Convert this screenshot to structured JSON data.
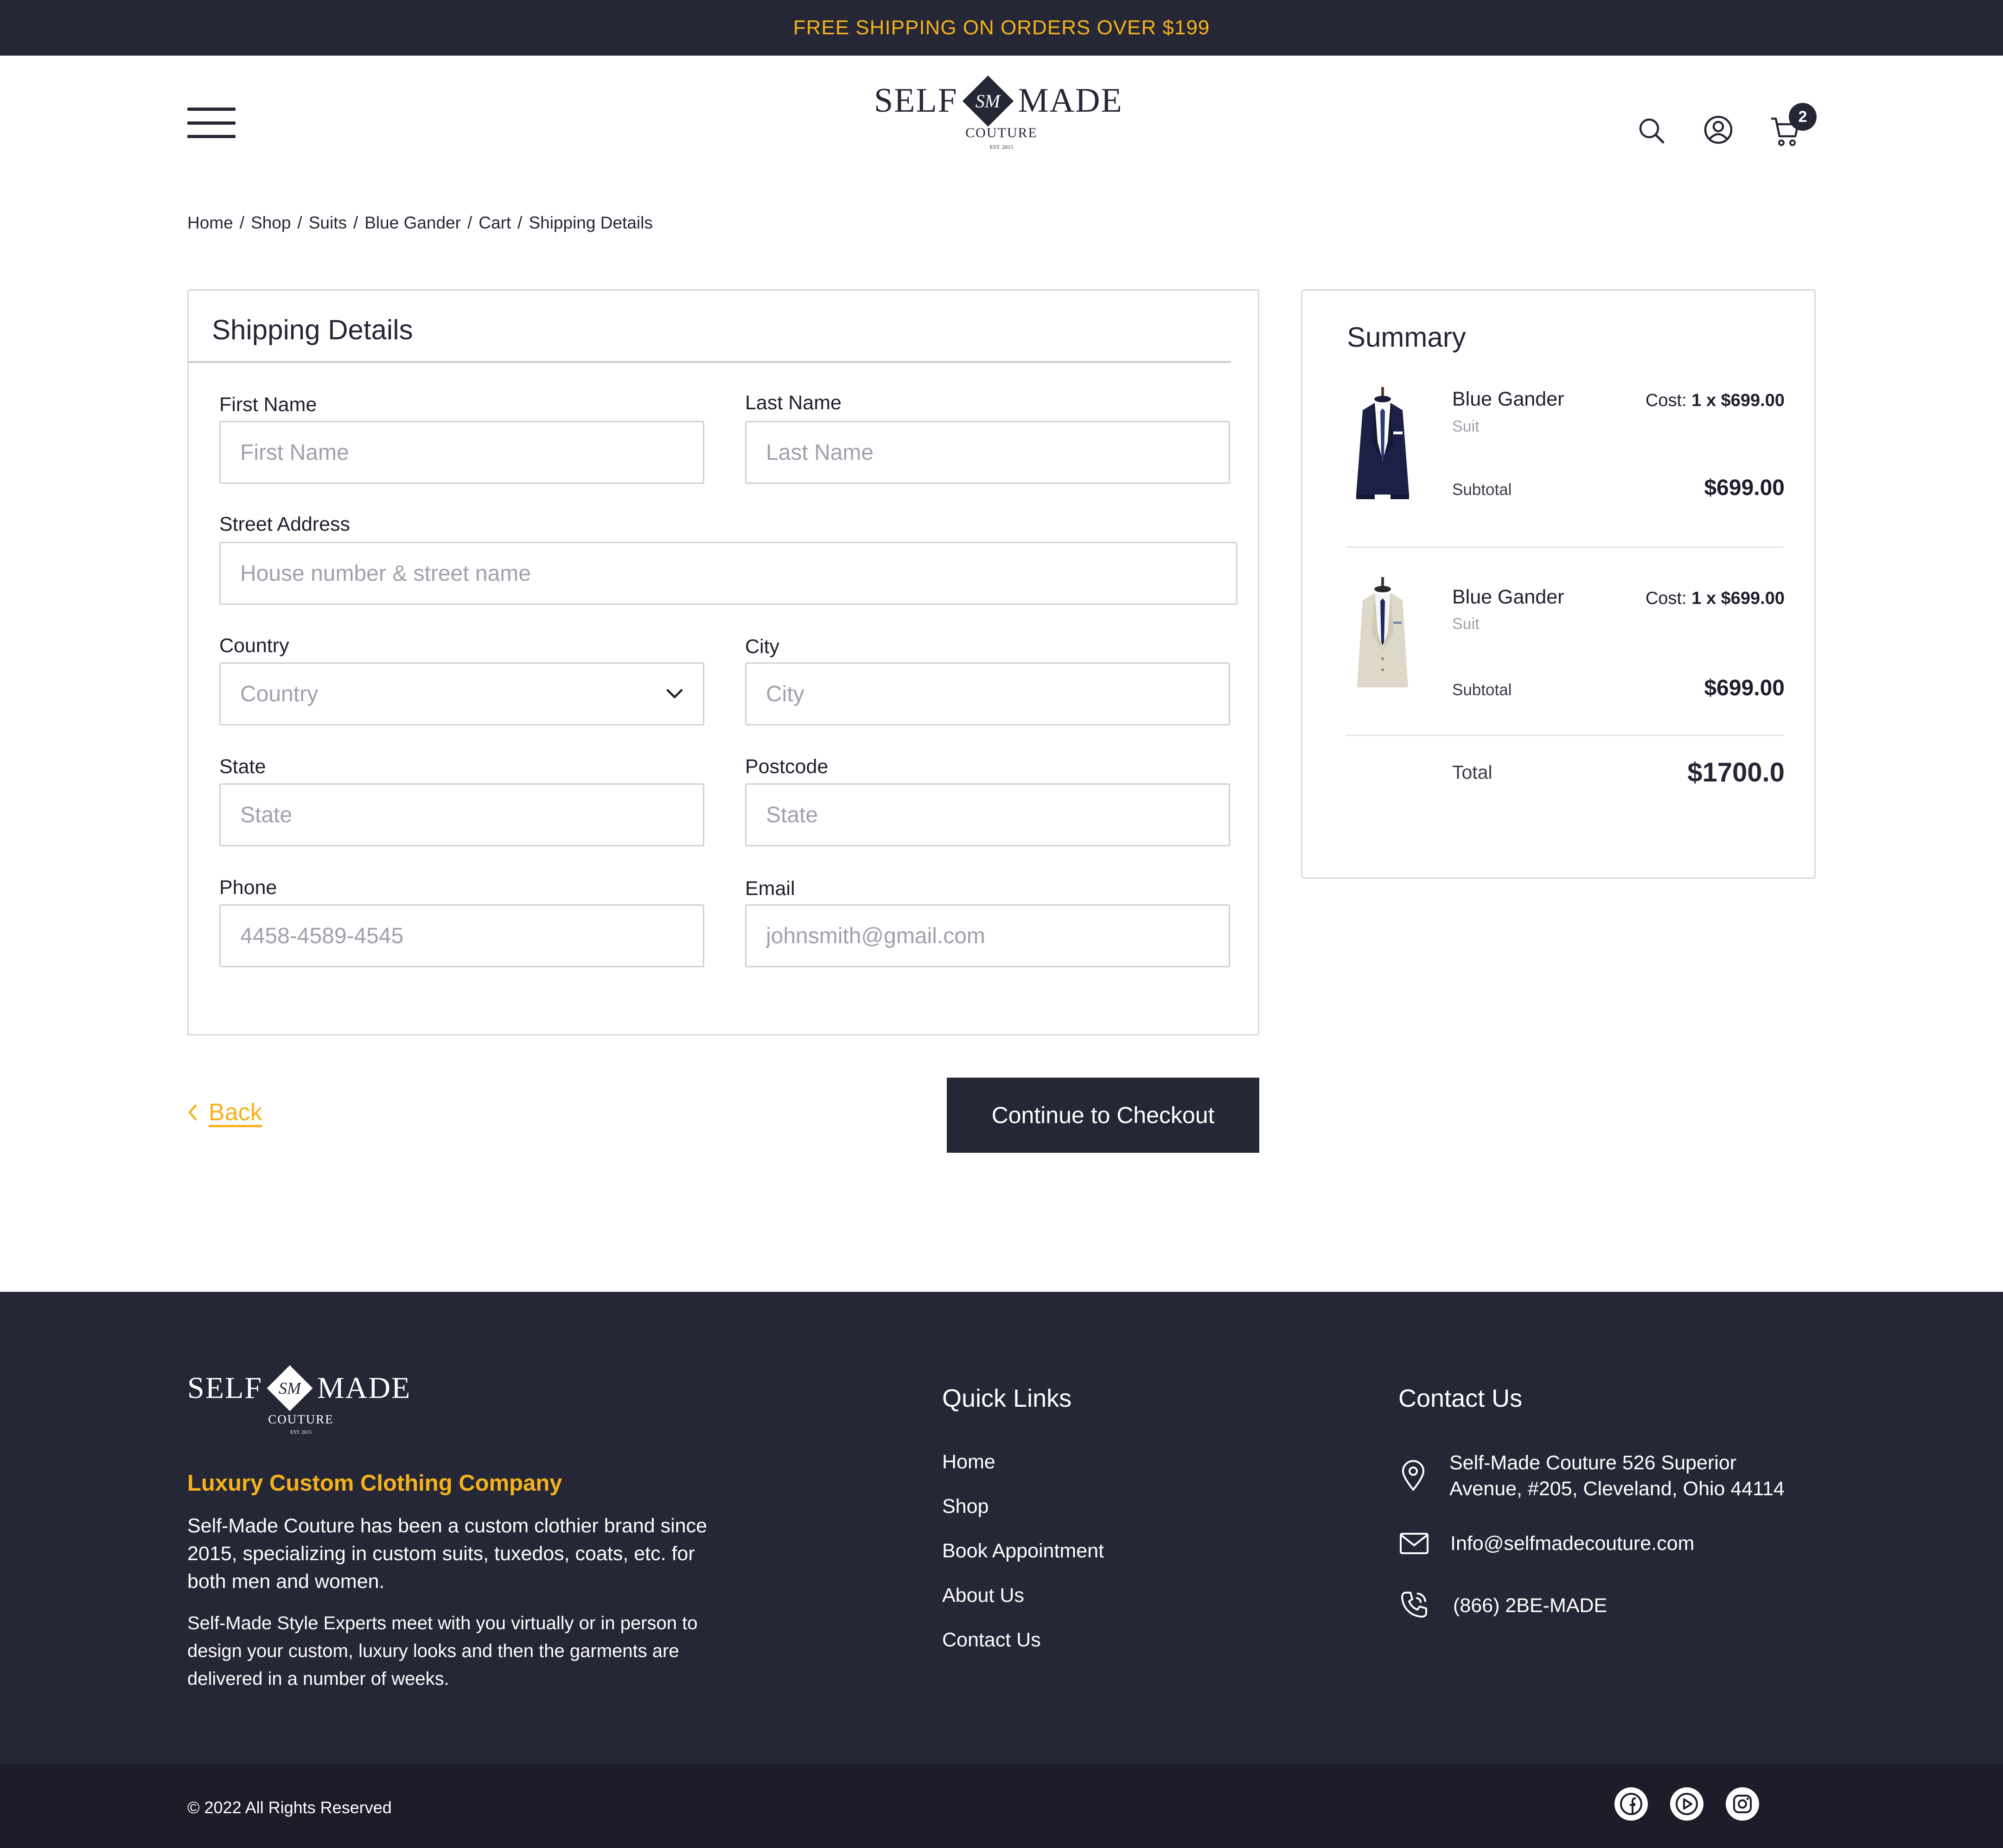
{
  "announcement": "FREE SHIPPING ON ORDERS OVER $199",
  "brand": {
    "word_left": "SELF",
    "word_right": "MADE",
    "monogram": "SM",
    "subtitle": "COUTURE",
    "est": "EST. 2015"
  },
  "header": {
    "menu_icon": "hamburger-menu-icon",
    "search_icon": "search-icon",
    "account_icon": "user-account-icon",
    "cart_icon": "shopping-cart-icon",
    "cart_count": "2"
  },
  "breadcrumb": [
    "Home",
    "Shop",
    "Suits",
    "Blue Gander",
    "Cart",
    "Shipping Details"
  ],
  "shipping": {
    "title": "Shipping Details",
    "first_name": {
      "label": "First Name",
      "placeholder": "First Name"
    },
    "last_name": {
      "label": "Last Name",
      "placeholder": "Last Name"
    },
    "street": {
      "label": "Street Address",
      "placeholder": "House number & street name"
    },
    "country": {
      "label": "Country",
      "placeholder": "Country"
    },
    "city": {
      "label": "City",
      "placeholder": "City"
    },
    "state": {
      "label": "State",
      "placeholder": "State"
    },
    "postcode": {
      "label": "Postcode",
      "placeholder": "State"
    },
    "phone": {
      "label": "Phone",
      "placeholder": "4458-4589-4545"
    },
    "email": {
      "label": "Email",
      "placeholder": "johnsmith@gmail.com"
    }
  },
  "summary": {
    "title": "Summary",
    "items": [
      {
        "name": "Blue Gander",
        "type": "Suit",
        "cost_label": "Cost:",
        "cost_value": "1 x $699.00",
        "subtotal_label": "Subtotal",
        "subtotal": "$699.00",
        "image": "navy-suit-image"
      },
      {
        "name": "Blue Gander",
        "type": "Suit",
        "cost_label": "Cost:",
        "cost_value": "1 x $699.00",
        "subtotal_label": "Subtotal",
        "subtotal": "$699.00",
        "image": "beige-suit-image"
      }
    ],
    "total_label": "Total",
    "total": "$1700.0"
  },
  "actions": {
    "back": "Back",
    "continue": "Continue to Checkout"
  },
  "footer": {
    "tagline": "Luxury Custom Clothing Company",
    "para1": "Self-Made Couture has been a custom clothier brand since 2015, specializing in custom suits, tuxedos, coats, etc. for both men and women.",
    "para2": "Self-Made Style Experts meet with you virtually or in person to design your custom, luxury looks and then the garments are delivered in a number of weeks.",
    "quick_links_title": "Quick Links",
    "quick_links": [
      "Home",
      "Shop",
      "Book Appointment",
      "About Us",
      "Contact Us"
    ],
    "contact_title": "Contact Us",
    "address": "Self-Made Couture 526 Superior Avenue, #205, Cleveland, Ohio 44114",
    "email": "Info@selfmadecouture.com",
    "phone": "(866) 2BE-MADE",
    "copyright": "© 2022 All Rights Reserved",
    "social": [
      "facebook-icon",
      "youtube-icon",
      "instagram-icon"
    ]
  },
  "colors": {
    "navy": "#252736",
    "accent": "#f5b21a",
    "border": "#cfd0d5"
  }
}
